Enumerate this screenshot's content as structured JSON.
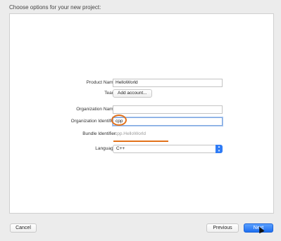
{
  "dialog": {
    "heading": "Choose options for your new project:"
  },
  "form": {
    "product_name_label": "Product Name:",
    "product_name_value": "HelloWorld",
    "team_label": "Team:",
    "team_button": "Add account...",
    "organization_name_label": "Organization Name:",
    "organization_name_value": "",
    "organization_identifier_label": "Organization Identifier:",
    "organization_identifier_value": "cpp",
    "bundle_identifier_label": "Bundle Identifier:",
    "bundle_identifier_value": "cpp.HelloWorld",
    "language_label": "Language:",
    "language_value": "C++"
  },
  "footer": {
    "cancel_label": "Cancel",
    "previous_label": "Previous",
    "next_label": "Next"
  },
  "colors": {
    "annotation": "#e2711a",
    "accent": "#1f6ff0"
  }
}
